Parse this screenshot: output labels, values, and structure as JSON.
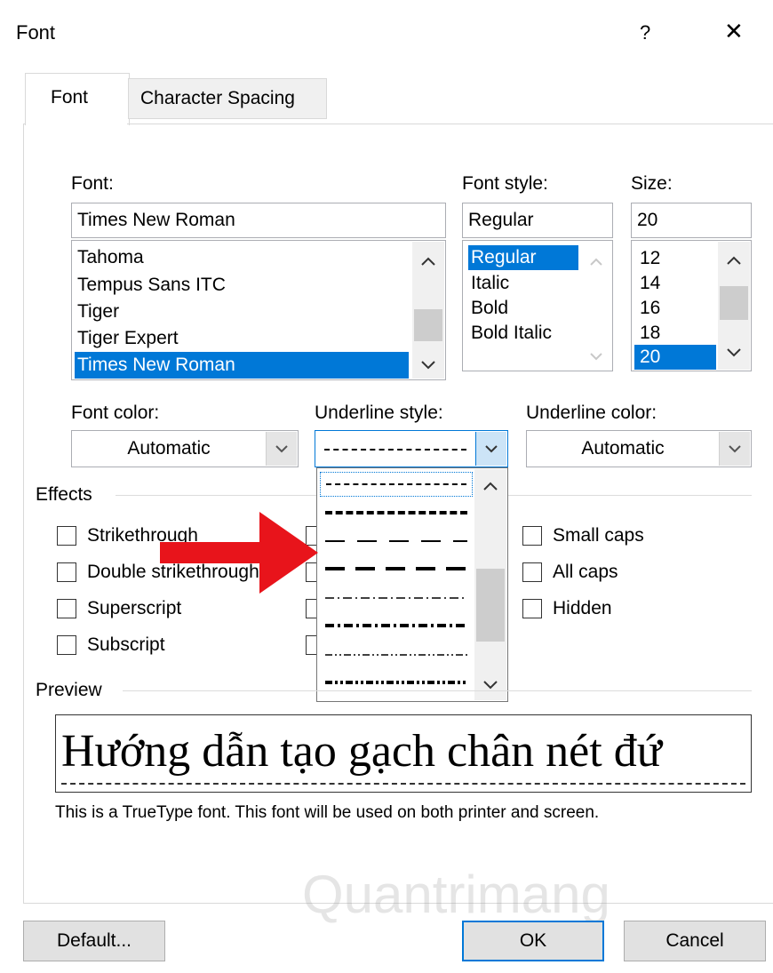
{
  "dialog": {
    "title": "Font",
    "help_label": "?",
    "close_label": "✕"
  },
  "tabs": [
    {
      "label": "Font",
      "active": true
    },
    {
      "label": "Character Spacing",
      "active": false
    }
  ],
  "font": {
    "label": "Font:",
    "value": "Times New Roman",
    "items": [
      "Tahoma",
      "Tempus Sans ITC",
      "Tiger",
      "Tiger Expert",
      "Times New Roman"
    ],
    "selected": "Times New Roman"
  },
  "font_style": {
    "label": "Font style:",
    "value": "Regular",
    "items": [
      "Regular",
      "Italic",
      "Bold",
      "Bold Italic"
    ],
    "selected": "Regular"
  },
  "size": {
    "label": "Size:",
    "value": "20",
    "items": [
      "12",
      "14",
      "16",
      "18",
      "20"
    ],
    "selected": "20"
  },
  "font_color": {
    "label": "Font color:",
    "value": "Automatic"
  },
  "underline_style": {
    "label": "Underline style:",
    "options": [
      "dash",
      "dash-heavy",
      "long-dash",
      "long-dash-heavy",
      "dot-dash",
      "dot-dash-heavy",
      "dot-dot-dash",
      "dot-dot-dash-heavy"
    ],
    "dropdown_open": true
  },
  "underline_color": {
    "label": "Underline color:",
    "value": "Automatic"
  },
  "effects": {
    "label": "Effects",
    "left": [
      "Strikethrough",
      "Double strikethrough",
      "Superscript",
      "Subscript"
    ],
    "right": [
      "Small caps",
      "All caps",
      "Hidden"
    ]
  },
  "preview": {
    "label": "Preview",
    "text": "Hướng dẫn tạo gạch chân nét đứ",
    "note": "This is a TrueType font. This font will be used on both printer and screen."
  },
  "buttons": {
    "default": "Default...",
    "ok": "OK",
    "cancel": "Cancel"
  },
  "watermark": "Quantrimang",
  "colors": {
    "selection": "#0078d7",
    "annotation_arrow": "#e8141b"
  }
}
